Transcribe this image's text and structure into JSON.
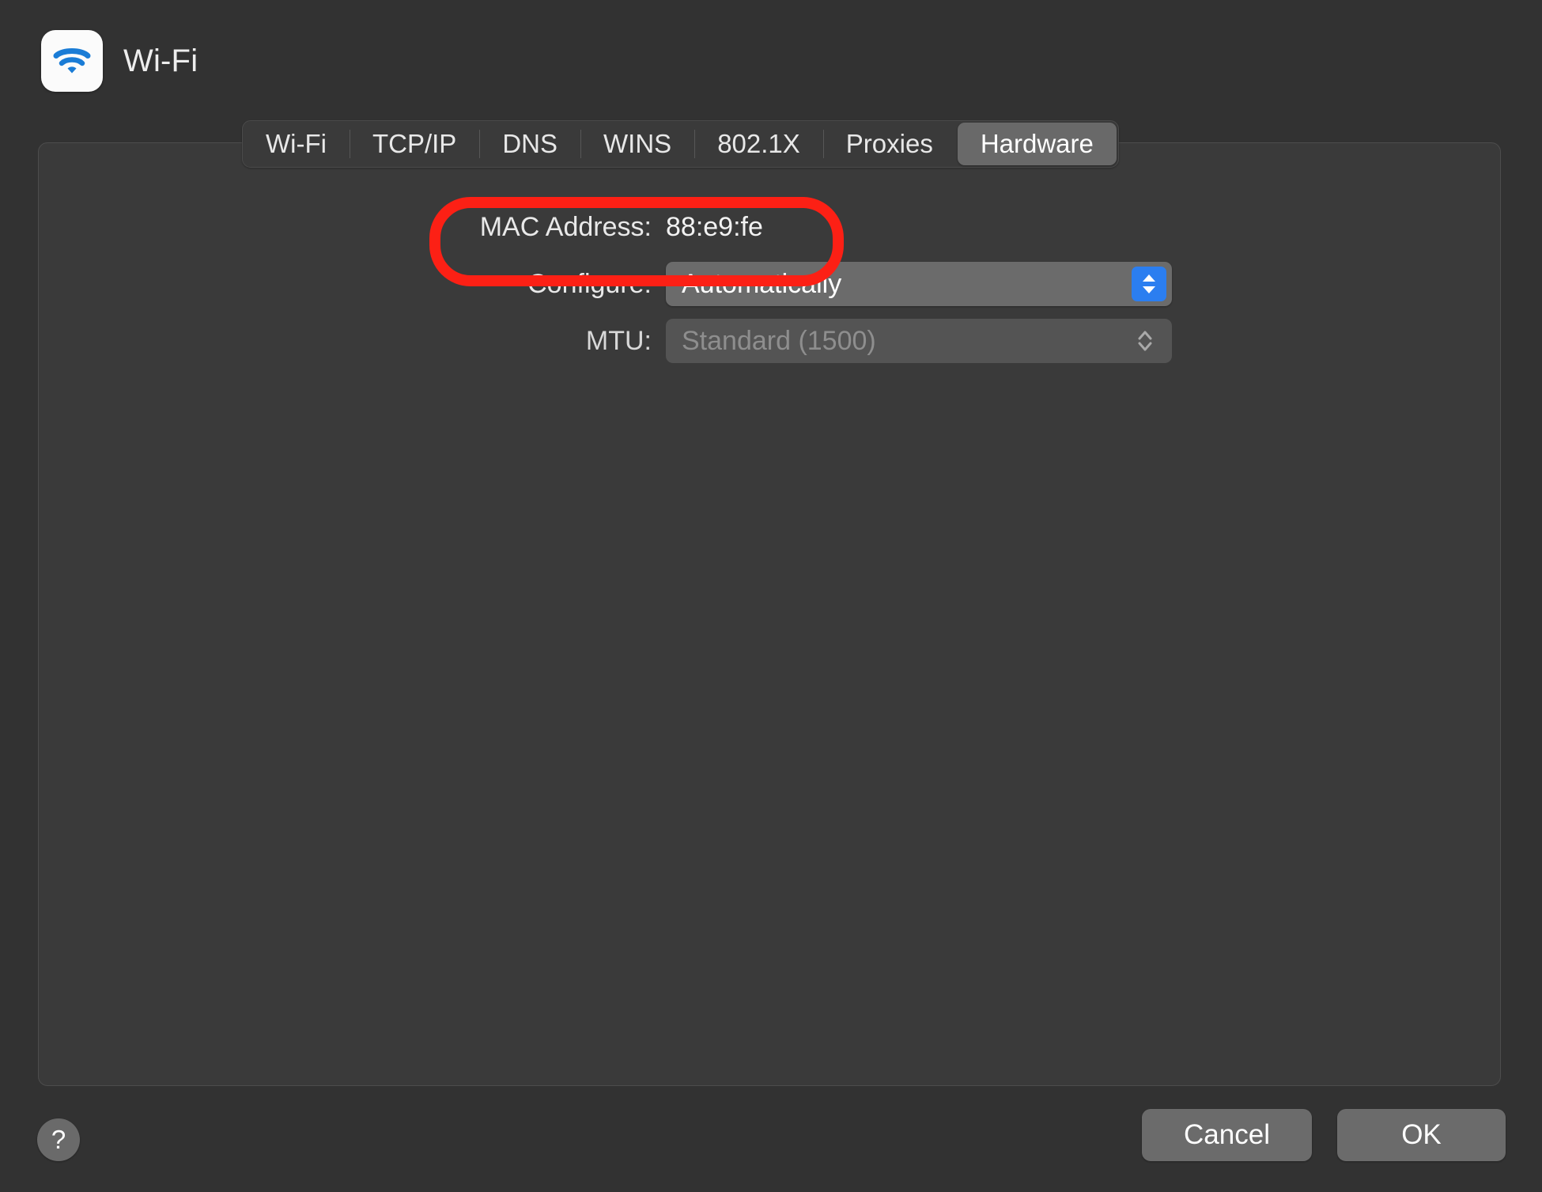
{
  "window": {
    "background_color": "#323232",
    "panel_color": "#3a3a3a"
  },
  "header": {
    "title": "Wi-Fi",
    "icon": "wifi-icon"
  },
  "tabs": [
    {
      "label": "Wi-Fi",
      "selected": false
    },
    {
      "label": "TCP/IP",
      "selected": false
    },
    {
      "label": "DNS",
      "selected": false
    },
    {
      "label": "WINS",
      "selected": false
    },
    {
      "label": "802.1X",
      "selected": false
    },
    {
      "label": "Proxies",
      "selected": false
    },
    {
      "label": "Hardware",
      "selected": true
    }
  ],
  "form": {
    "mac_address": {
      "label": "MAC Address:",
      "value": "88:e9:fe"
    },
    "configure": {
      "label": "Configure:",
      "value": "Automatically",
      "indicator_color": "#2b7ef0",
      "indicator_icon": "chevron-up-down-icon",
      "enabled": true
    },
    "mtu": {
      "label": "MTU:",
      "value": "Standard  (1500)",
      "indicator_icon": "chevron-up-down-icon",
      "enabled": false
    }
  },
  "footer": {
    "help_label": "?",
    "cancel_label": "Cancel",
    "ok_label": "OK"
  },
  "annotation": {
    "color": "#fc2015",
    "target": "MAC Address row"
  }
}
